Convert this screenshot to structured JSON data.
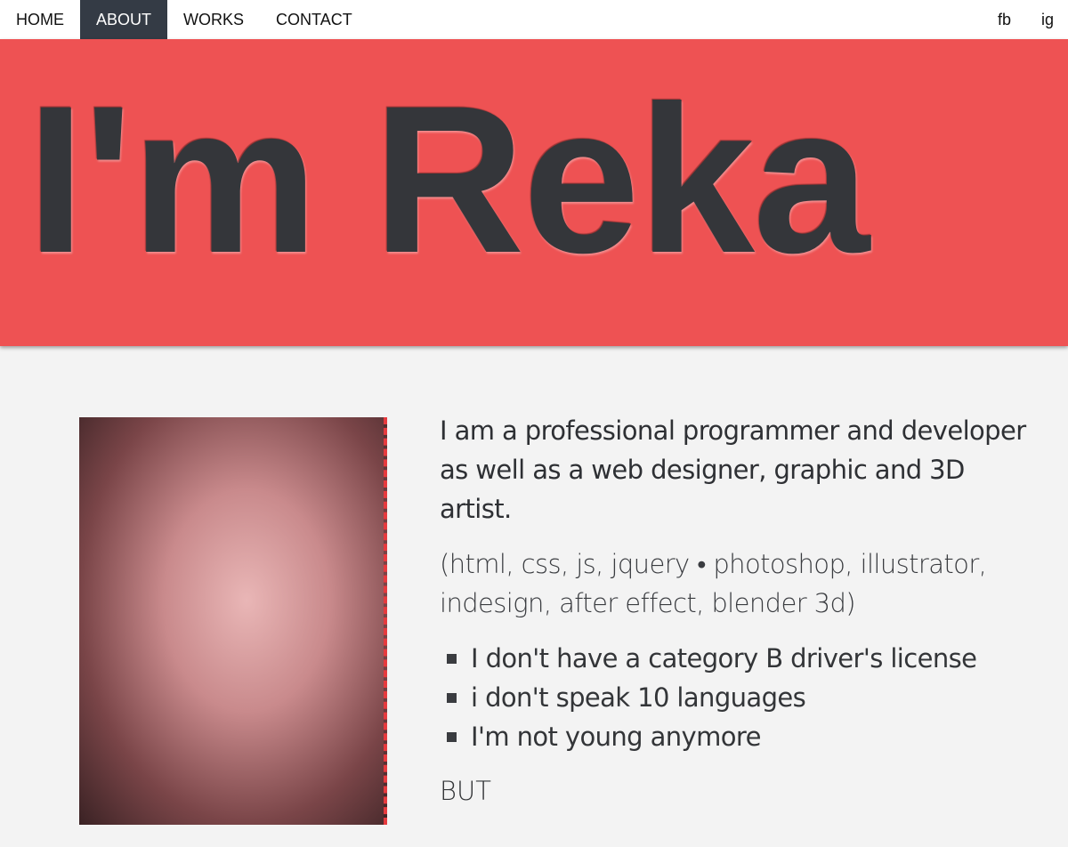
{
  "nav": {
    "items": [
      {
        "label": "HOME"
      },
      {
        "label": "ABOUT",
        "active": true
      },
      {
        "label": "WORKS"
      },
      {
        "label": "CONTACT"
      }
    ],
    "social": [
      {
        "label": "fb"
      },
      {
        "label": "ig"
      }
    ]
  },
  "hero": {
    "title": "I'm Reka"
  },
  "about": {
    "intro": "I am a professional programmer and developer as well as a web designer, graphic and 3D artist.",
    "skills": "(html, css, js, jquery • photoshop, illustrator, indesign, after effect, blender 3d)",
    "list": [
      "I don't have a category B driver's license",
      "i don't speak 10 languages",
      "I'm not young anymore"
    ],
    "but": "BUT"
  },
  "colors": {
    "accent": "#ee5253",
    "dark": "#343b45",
    "background": "#f3f3f3"
  }
}
